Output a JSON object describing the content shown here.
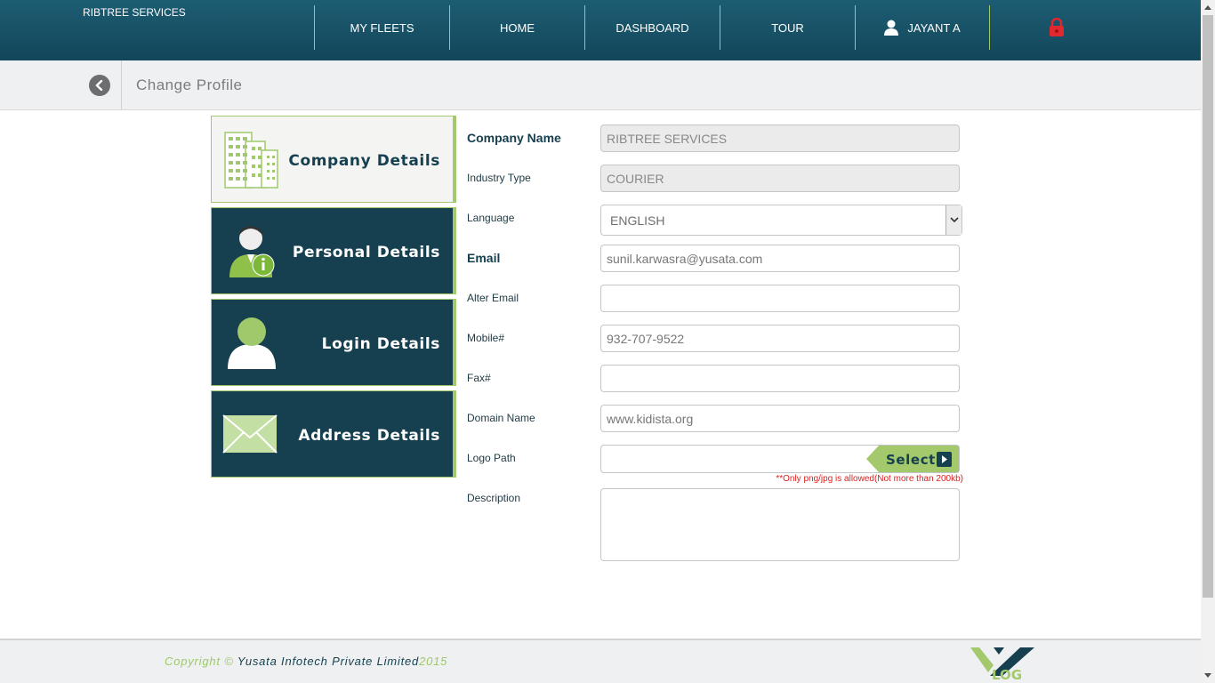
{
  "app": {
    "brand": "RIBTREE SERVICES"
  },
  "nav": {
    "items": [
      "MY FLEETS",
      "HOME",
      "DASHBOARD",
      "TOUR"
    ],
    "user": "JAYANT A"
  },
  "subheader": {
    "title": "Change Profile"
  },
  "tabs": [
    {
      "label": "Company Details",
      "active": true
    },
    {
      "label": "Personal Details",
      "active": false
    },
    {
      "label": "Login Details",
      "active": false
    },
    {
      "label": "Address Details",
      "active": false
    }
  ],
  "form": {
    "company_name": {
      "label": "Company Name",
      "value": "RIBTREE SERVICES"
    },
    "industry_type": {
      "label": "Industry Type",
      "value": "COURIER"
    },
    "language": {
      "label": "Language",
      "value": "ENGLISH"
    },
    "email": {
      "label": "Email",
      "value": "sunil.karwasra@yusata.com"
    },
    "alter_email": {
      "label": "Alter Email",
      "value": ""
    },
    "mobile": {
      "label": "Mobile#",
      "value": "932-707-9522"
    },
    "fax": {
      "label": "Fax#",
      "value": ""
    },
    "domain_name": {
      "label": "Domain Name",
      "value": "www.kidista.org"
    },
    "logo_path": {
      "label": "Logo Path",
      "button": "Select",
      "note": "**Only png/jpg is allowed(Not more than 200kb)"
    },
    "description": {
      "label": "Description",
      "value": ""
    }
  },
  "footer": {
    "copyright_prefix": "Copyright ©",
    "company": "Yusata Infotech Private Limited",
    "year": "2015",
    "logo_text": "LOG"
  },
  "colors": {
    "header": "#13465a",
    "accent_green": "#9fc96b",
    "tab_dark": "#163f4f",
    "lock": "#e0282e"
  },
  "icons": [
    "user-icon",
    "lock-icon",
    "back-arrow-icon",
    "building-icon",
    "person-info-icon",
    "person-icon",
    "envelope-icon",
    "play-icon",
    "chevron-down-icon"
  ]
}
